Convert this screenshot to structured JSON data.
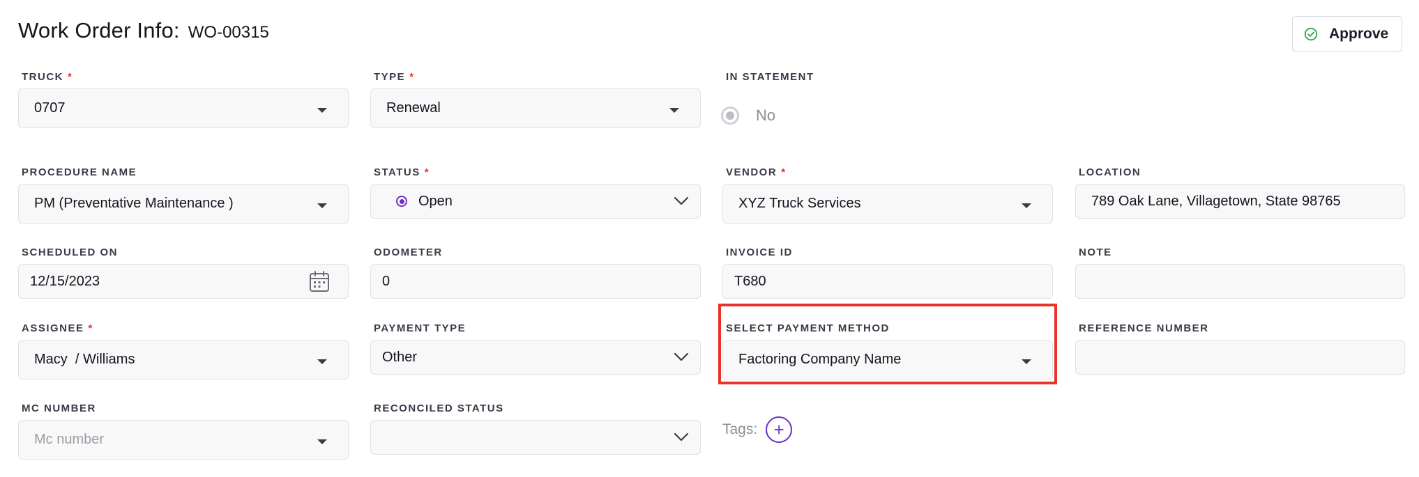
{
  "header": {
    "title": "Work Order Info:",
    "work_order_id": "WO-00315",
    "approve_label": "Approve"
  },
  "fields": {
    "truck": {
      "label": "TRUCK",
      "required": "*",
      "value": "0707"
    },
    "type": {
      "label": "TYPE",
      "required": "*",
      "value": "Renewal"
    },
    "in_statement": {
      "label": "IN STATEMENT",
      "value": "No"
    },
    "procedure_name": {
      "label": "PROCEDURE NAME",
      "value": "PM (Preventative Maintenance )"
    },
    "status": {
      "label": "STATUS",
      "required": "*",
      "value": "Open"
    },
    "vendor": {
      "label": "VENDOR",
      "required": "*",
      "value": "XYZ Truck Services"
    },
    "location": {
      "label": "LOCATION",
      "value": "789 Oak Lane, Villagetown, State 98765"
    },
    "scheduled_on": {
      "label": "SCHEDULED ON",
      "value": "12/15/2023"
    },
    "odometer": {
      "label": "ODOMETER",
      "value": "0"
    },
    "invoice_id": {
      "label": "INVOICE ID",
      "value": "T680"
    },
    "note": {
      "label": "NOTE",
      "value": ""
    },
    "assignee": {
      "label": "ASSIGNEE",
      "required": "*",
      "value": "Macy  / Williams"
    },
    "payment_type": {
      "label": "PAYMENT TYPE",
      "value": "Other"
    },
    "payment_method": {
      "label": "SELECT PAYMENT METHOD",
      "value": "Factoring Company Name"
    },
    "reference_number": {
      "label": "REFERENCE NUMBER",
      "value": ""
    },
    "mc_number": {
      "label": "MC NUMBER",
      "placeholder": "Mc number"
    },
    "reconciled_status": {
      "label": "RECONCILED STATUS",
      "value": ""
    }
  },
  "tags": {
    "label": "Tags:",
    "add_symbol": "+"
  },
  "colors": {
    "accent": "#6d2fc7",
    "required": "#e0302a",
    "highlight": "#e8322a",
    "approve_check": "#2ea44f"
  },
  "icons": {
    "approve": "check-circle-icon",
    "scheduled_on": "calendar-icon",
    "dropdown": "caret-down-icon",
    "select": "chevron-down-icon"
  }
}
